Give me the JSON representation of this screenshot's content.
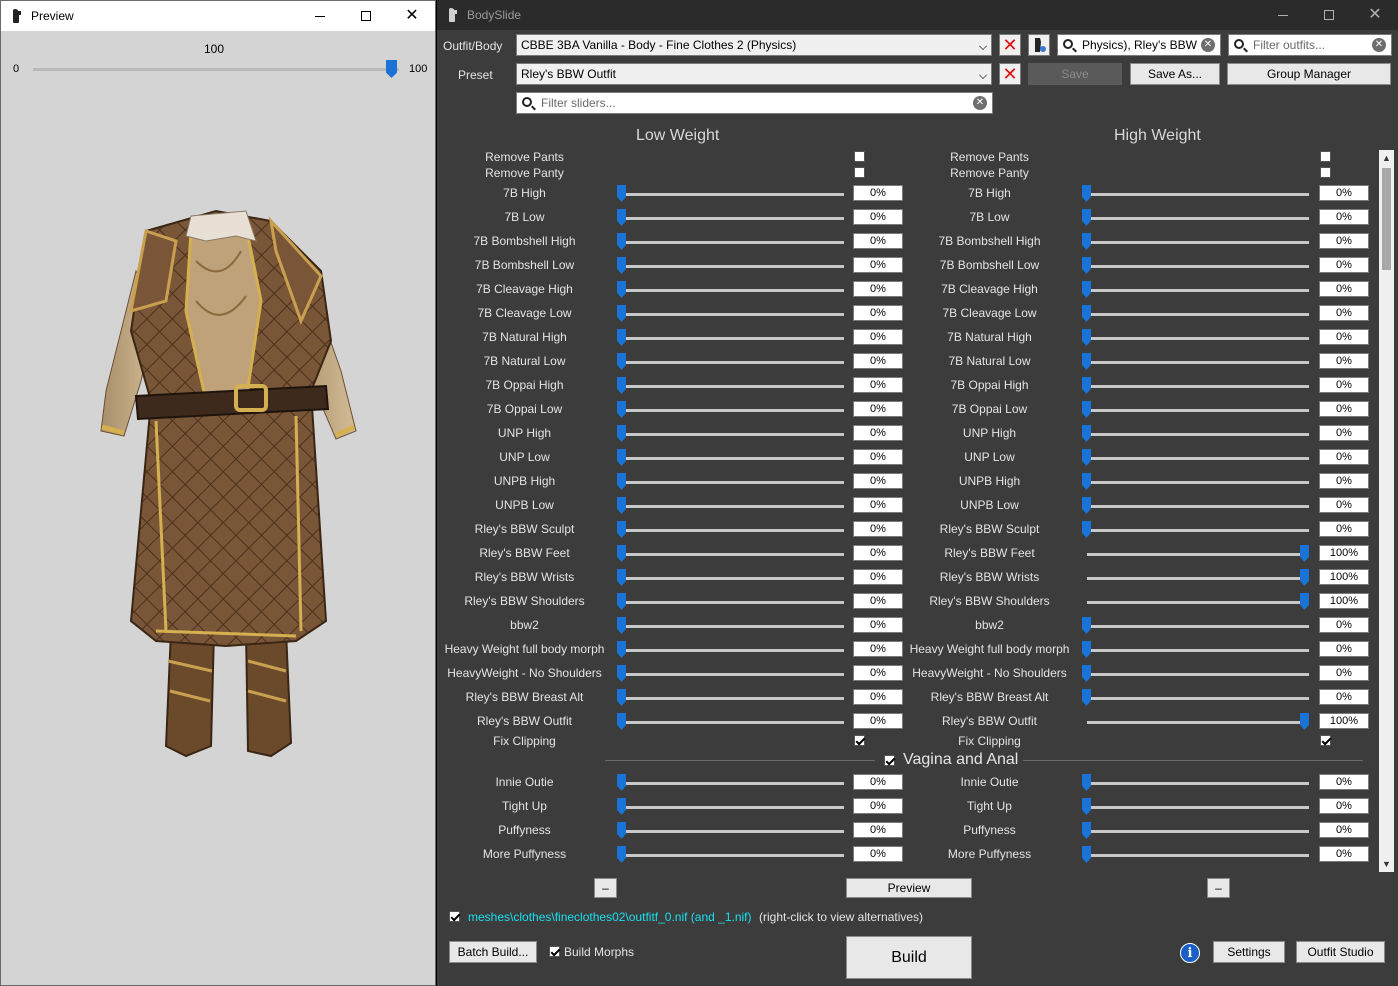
{
  "preview": {
    "title": "Preview",
    "slider_value": "100",
    "slider_min": "0",
    "slider_max": "100",
    "slider_fraction": 1.0
  },
  "main": {
    "title": "BodySlide",
    "outfit_label": "Outfit/Body",
    "outfit_value": "CBBE 3BA Vanilla - Body - Fine Clothes 2 (Physics)",
    "preset_label": "Preset",
    "preset_value": "Rley's BBW Outfit",
    "group_filter_value": "Physics), Rley's BBW",
    "outfit_filter_placeholder": "Filter outfits...",
    "slider_filter_placeholder": "Filter sliders...",
    "save_label": "Save",
    "save_as_label": "Save As...",
    "group_manager_label": "Group Manager",
    "low_weight_label": "Low Weight",
    "high_weight_label": "High Weight",
    "group2_title": "Vagina and Anal",
    "minus_left": "–",
    "minus_right": "–",
    "preview_button": "Preview",
    "output_path": "meshes\\clothes\\fineclothes02\\outfitf_0.nif (and _1.nif)",
    "output_hint": "(right-click to view alternatives)",
    "batch_build_label": "Batch Build...",
    "build_morphs_label": "Build Morphs",
    "build_label": "Build",
    "settings_label": "Settings",
    "outfit_studio_label": "Outfit Studio",
    "info_glyph": "i"
  },
  "checks_top": [
    {
      "label": "Remove Pants",
      "low": false,
      "high": false
    },
    {
      "label": "Remove Panty",
      "low": false,
      "high": false
    }
  ],
  "sliders": [
    {
      "label": "7B High",
      "low": "0%",
      "high": "0%",
      "low_frac": 0,
      "high_frac": 0
    },
    {
      "label": "7B Low",
      "low": "0%",
      "high": "0%",
      "low_frac": 0,
      "high_frac": 0
    },
    {
      "label": "7B Bombshell High",
      "low": "0%",
      "high": "0%",
      "low_frac": 0,
      "high_frac": 0
    },
    {
      "label": "7B Bombshell Low",
      "low": "0%",
      "high": "0%",
      "low_frac": 0,
      "high_frac": 0
    },
    {
      "label": "7B Cleavage High",
      "low": "0%",
      "high": "0%",
      "low_frac": 0,
      "high_frac": 0
    },
    {
      "label": "7B Cleavage Low",
      "low": "0%",
      "high": "0%",
      "low_frac": 0,
      "high_frac": 0
    },
    {
      "label": "7B Natural High",
      "low": "0%",
      "high": "0%",
      "low_frac": 0,
      "high_frac": 0
    },
    {
      "label": "7B Natural Low",
      "low": "0%",
      "high": "0%",
      "low_frac": 0,
      "high_frac": 0
    },
    {
      "label": "7B Oppai High",
      "low": "0%",
      "high": "0%",
      "low_frac": 0,
      "high_frac": 0
    },
    {
      "label": "7B Oppai Low",
      "low": "0%",
      "high": "0%",
      "low_frac": 0,
      "high_frac": 0
    },
    {
      "label": "UNP High",
      "low": "0%",
      "high": "0%",
      "low_frac": 0,
      "high_frac": 0
    },
    {
      "label": "UNP Low",
      "low": "0%",
      "high": "0%",
      "low_frac": 0,
      "high_frac": 0
    },
    {
      "label": "UNPB High",
      "low": "0%",
      "high": "0%",
      "low_frac": 0,
      "high_frac": 0
    },
    {
      "label": "UNPB Low",
      "low": "0%",
      "high": "0%",
      "low_frac": 0,
      "high_frac": 0
    },
    {
      "label": "Rley's BBW Sculpt",
      "low": "0%",
      "high": "0%",
      "low_frac": 0,
      "high_frac": 0
    },
    {
      "label": "Rley's BBW Feet",
      "low": "0%",
      "high": "100%",
      "low_frac": 0,
      "high_frac": 1
    },
    {
      "label": "Rley's BBW Wrists",
      "low": "0%",
      "high": "100%",
      "low_frac": 0,
      "high_frac": 1
    },
    {
      "label": "Rley's BBW Shoulders",
      "low": "0%",
      "high": "100%",
      "low_frac": 0,
      "high_frac": 1
    },
    {
      "label": "bbw2",
      "low": "0%",
      "high": "0%",
      "low_frac": 0,
      "high_frac": 0
    },
    {
      "label": "Heavy Weight full body morph",
      "low": "0%",
      "high": "0%",
      "low_frac": 0,
      "high_frac": 0
    },
    {
      "label": "HeavyWeight - No Shoulders",
      "low": "0%",
      "high": "0%",
      "low_frac": 0,
      "high_frac": 0
    },
    {
      "label": "Rley's BBW Breast Alt",
      "low": "0%",
      "high": "0%",
      "low_frac": 0,
      "high_frac": 0
    },
    {
      "label": "Rley's BBW Outfit",
      "low": "0%",
      "high": "100%",
      "low_frac": 0,
      "high_frac": 1
    }
  ],
  "check_fix": {
    "label": "Fix Clipping",
    "low": true,
    "high": true
  },
  "group2_checked": true,
  "sliders2": [
    {
      "label": "Innie Outie",
      "low": "0%",
      "high": "0%",
      "low_frac": 0,
      "high_frac": 0
    },
    {
      "label": "Tight Up",
      "low": "0%",
      "high": "0%",
      "low_frac": 0,
      "high_frac": 0
    },
    {
      "label": "Puffyness",
      "low": "0%",
      "high": "0%",
      "low_frac": 0,
      "high_frac": 0
    },
    {
      "label": "More Puffyness",
      "low": "0%",
      "high": "0%",
      "low_frac": 0,
      "high_frac": 0
    }
  ],
  "colors": {
    "accent": "#1a73d6",
    "panel_bg": "#3c3c3c",
    "preview_bg": "#d4d4d4",
    "path_text": "#18e0f0",
    "delete_red": "#e01010"
  }
}
